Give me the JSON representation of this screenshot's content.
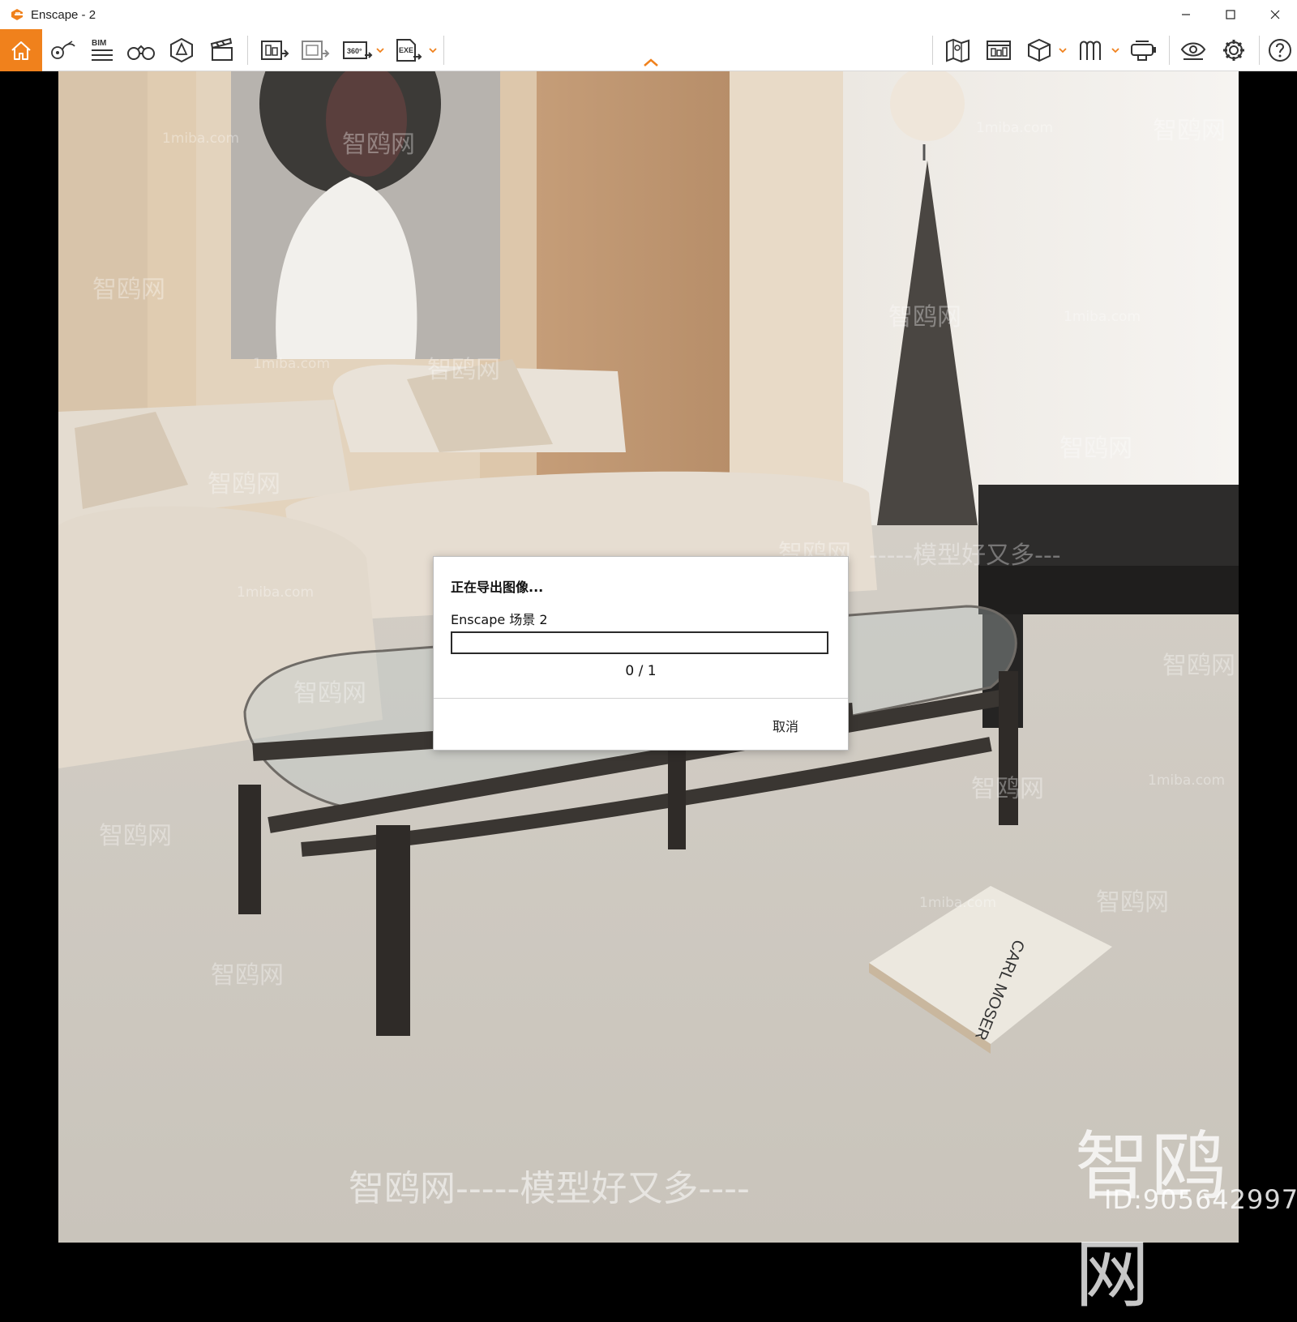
{
  "window": {
    "title": "Enscape - 2",
    "accent": "#f0811c"
  },
  "toolbar": {
    "left_buttons": [
      {
        "name": "home",
        "icon": "home-icon"
      },
      {
        "name": "views",
        "icon": "map-pin-icon"
      },
      {
        "name": "bim",
        "icon": "bim-icon",
        "label": "BIM"
      },
      {
        "name": "binoculars",
        "icon": "binoculars-icon"
      },
      {
        "name": "asset-library",
        "icon": "asset-icon"
      },
      {
        "name": "video-editor",
        "icon": "clapperboard-icon"
      },
      {
        "name": "render-image",
        "icon": "render-image-icon"
      },
      {
        "name": "batch-render",
        "icon": "batch-render-icon"
      },
      {
        "name": "panorama",
        "icon": "panorama-360-icon",
        "label": "360°"
      },
      {
        "name": "export-exe",
        "icon": "export-exe-icon",
        "label": "EXE"
      }
    ],
    "right_buttons": [
      {
        "name": "map",
        "icon": "map-icon"
      },
      {
        "name": "web-standalone",
        "icon": "web-icon"
      },
      {
        "name": "cube",
        "icon": "cube-icon"
      },
      {
        "name": "panorama-gallery",
        "icon": "gallery-icon"
      },
      {
        "name": "vr-headset",
        "icon": "vr-headset-icon"
      },
      {
        "name": "visual-settings",
        "icon": "eye-icon"
      },
      {
        "name": "settings",
        "icon": "gear-icon"
      },
      {
        "name": "help",
        "icon": "help-icon"
      }
    ]
  },
  "dialog": {
    "title": "正在导出图像...",
    "scene": "Enscape 场景 2",
    "progress": 0.0,
    "count": "0 / 1",
    "cancel": "取消"
  },
  "watermarks": {
    "big": "智鸥网",
    "id": "ID:905642997",
    "bottom": "智鸥网-----模型好又多----",
    "small_a": "1miba.com",
    "small_b": "智鸥网",
    "small_c": "-----模型好又多---"
  }
}
